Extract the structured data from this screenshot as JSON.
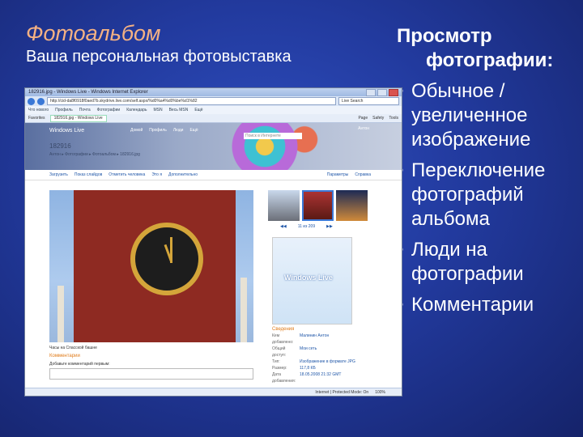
{
  "slide": {
    "title": "Фотоальбом",
    "subtitle": "Ваша персональная фотовыставка",
    "heading_line1": "Просмотр",
    "heading_line2": "фотографии:",
    "bullets": [
      "Обычное / увеличенное изображение",
      "Переключение фотографий альбома",
      "Люди на фотографии",
      "Комментарии"
    ]
  },
  "browser": {
    "window_title": "182916.jpg - Windows Live - Windows Internet Explorer",
    "url": "http://cid-da8f0918f0aed7b.skydrive.live.com/self.aspx/%d0%a4%d0%be%d1%82",
    "search_text": "Live Search",
    "menu": [
      "Что нового",
      "Профиль",
      "Почта",
      "Фотографии",
      "Календарь",
      "MSN",
      "Весь MSN",
      "Ещё"
    ],
    "favorites": "Favorites",
    "tab_label": "182916.jpg - Windows Live",
    "page_menu": [
      "Page",
      "Safety",
      "Tools"
    ],
    "status": [
      "Internet | Protected Mode: On",
      "100%"
    ]
  },
  "live": {
    "brand": "Windows Live",
    "nav": [
      "Домой",
      "Профиль",
      "Люди",
      "Ещё"
    ],
    "search_placeholder": "Поиск в Интернете",
    "user": "Антон",
    "photo_id": "182916",
    "breadcrumb": "Антон ▸ Фотографии ▸ Фотоальбом ▸ 182916.jpg",
    "actions": [
      "Загрузить",
      "Показ слайдов",
      "Отметить человека",
      "Это я",
      "Дополнительно"
    ],
    "actions_right": [
      "Параметры",
      "Справка"
    ],
    "caption": "Часы на Спасской башне",
    "comments_title": "Комментарии",
    "add_comment": "Добавьте комментарий первым:",
    "pager": "11 из 209",
    "promo": "Windows Live",
    "info_title": "Сведения",
    "info_rows": [
      {
        "k": "Кем добавлено:",
        "v": "Малинин Антон"
      },
      {
        "k": "Общий доступ:",
        "v": "Мои сеть"
      },
      {
        "k": "Тип:",
        "v": "Изображение в формате JPG"
      },
      {
        "k": "Размер:",
        "v": "117,8 КБ"
      },
      {
        "k": "Дата добавления:",
        "v": "18.05.2008 21:32 GMT"
      }
    ]
  },
  "colors": {
    "title": "#f4b183",
    "accent": "#e07b1a",
    "link": "#1f56a8"
  }
}
